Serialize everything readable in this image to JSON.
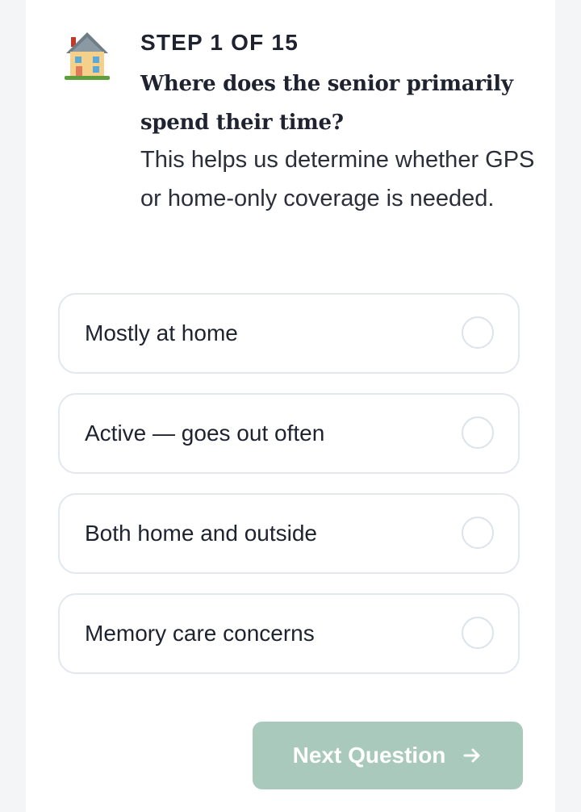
{
  "header": {
    "icon": "house-icon",
    "step_label": "STEP 1 OF 15",
    "question": "Where does the senior primarily spend their time?",
    "description": "This helps us determine whether GPS or home-only coverage is needed."
  },
  "options": [
    {
      "label": "Mostly at home",
      "selected": false
    },
    {
      "label": "Active — goes out often",
      "selected": false
    },
    {
      "label": "Both home and outside",
      "selected": false
    },
    {
      "label": "Memory care concerns",
      "selected": false
    }
  ],
  "footer": {
    "next_label": "Next Question",
    "next_icon": "arrow-right-icon",
    "next_enabled": false
  },
  "colors": {
    "accent_disabled": "#a9c9bc",
    "text_primary": "#1f2330",
    "border": "#e3e8ee"
  }
}
